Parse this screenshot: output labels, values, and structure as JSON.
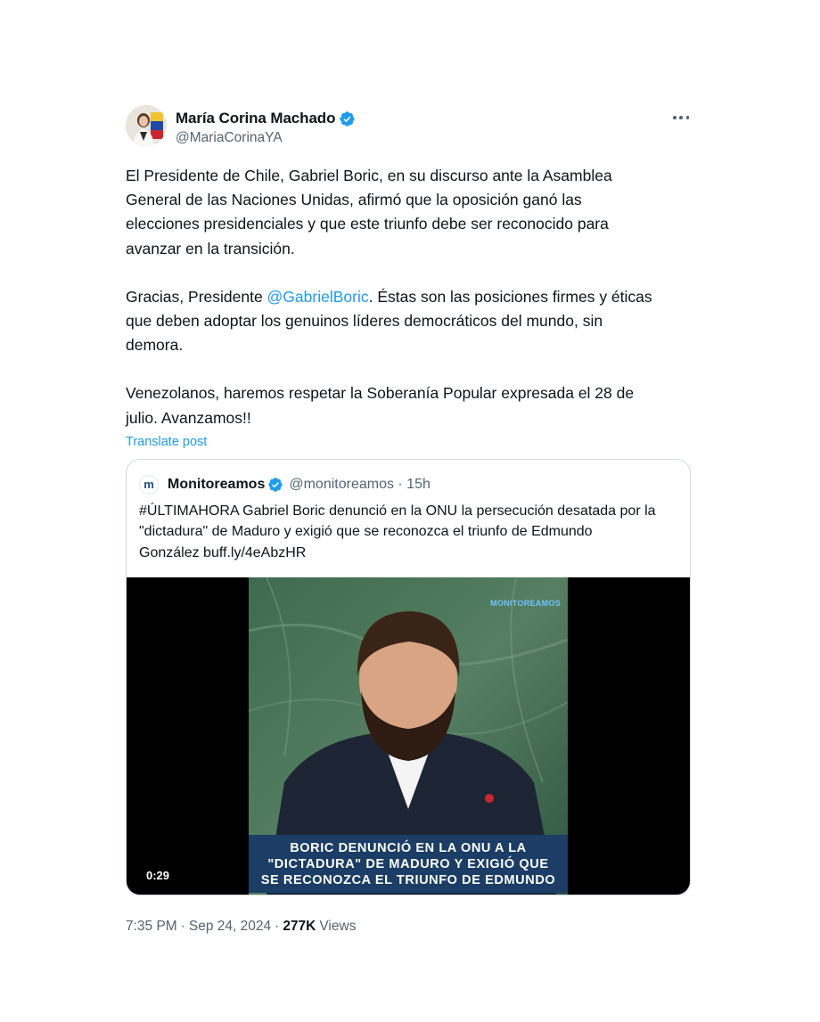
{
  "author": {
    "display_name": "María Corina Machado",
    "handle": "@MariaCorinaYA",
    "verified_icon": "verified-badge-icon",
    "verified_color": "#1d9bf0"
  },
  "tweet": {
    "paragraph1": {
      "line1": "El Presidente de Chile, Gabriel Boric, en su discurso ante la Asamblea",
      "line2": "General de las Naciones Unidas, afirmó que la oposición ganó las",
      "line3": "elecciones presidenciales y que este triunfo debe ser reconocido para",
      "line4": "avanzar en la transición."
    },
    "paragraph2": {
      "prefix": "Gracias, Presidente ",
      "mention": "@GabrielBoric",
      "suffix": ". Éstas son las posiciones firmes y éticas",
      "line2": "que deben adoptar los genuinos líderes democráticos del mundo, sin",
      "line3": "demora."
    },
    "paragraph3": {
      "line1": "Venezolanos, haremos respetar la Soberanía Popular expresada el 28 de",
      "line2": "julio. Avanzamos!!"
    },
    "translate_label": "Translate post",
    "link_color": "#1d9bf0"
  },
  "quote": {
    "avatar_letter": "m",
    "display_name": "Monitoreamos",
    "handle_time": "@monitoreamos · 15h",
    "text": {
      "line1": "#ÚLTIMAHORA Gabriel Boric denunció en la ONU la persecución desatada por la",
      "line2": "\"dictadura\" de Maduro y exigió que se reconozca el triunfo de Edmundo",
      "line3": "González buff.ly/4eAbzHR"
    },
    "video": {
      "duration": "0:29",
      "watermark": "MONITOREAMOS",
      "caption": {
        "line1": "BORIC DENUNCIÓ EN LA ONU A LA",
        "line2": "\"DICTADURA\" DE MADURO Y EXIGIÓ QUE",
        "line3": "SE RECONOZCA EL TRIUNFO DE EDMUNDO"
      },
      "caption_bg": "#1b3d66"
    }
  },
  "meta": {
    "time": "7:35 PM",
    "separator": "·",
    "date": "Sep 24, 2024",
    "views_count": "277K",
    "views_label": "Views"
  }
}
